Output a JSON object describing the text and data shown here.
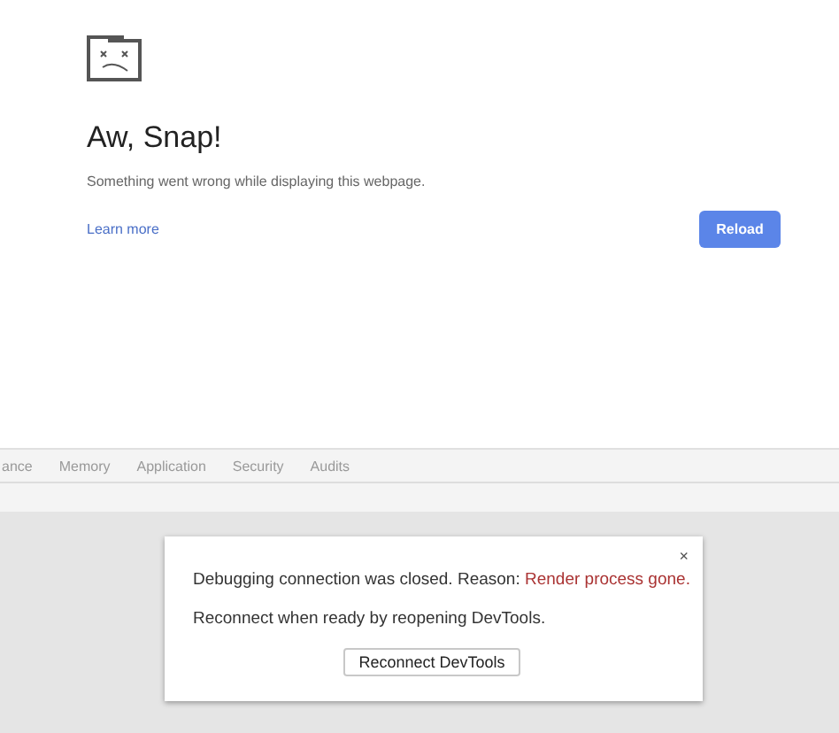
{
  "error_page": {
    "title": "Aw, Snap!",
    "message": "Something went wrong while displaying this webpage.",
    "link": "Learn more",
    "button": "Reload"
  },
  "devtools": {
    "tabs": [
      {
        "label": "ance",
        "selected": false
      },
      {
        "label": "Memory",
        "selected": false
      },
      {
        "label": "Application",
        "selected": false
      },
      {
        "label": "Security",
        "selected": false
      },
      {
        "label": "Audits",
        "selected": false
      }
    ],
    "dialog": {
      "close": "×",
      "message": "Debugging connection was closed. Reason:",
      "reason": "Render process gone.",
      "hint": "Reconnect when ready by reopening DevTools.",
      "button": "Reconnect DevTools"
    }
  }
}
